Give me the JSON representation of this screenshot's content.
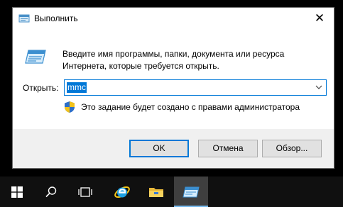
{
  "dialog": {
    "title": "Выполнить",
    "close_glyph": "✕",
    "description": "Введите имя программы, папки, документа или ресурса Интернета, которые требуется открыть.",
    "open_label": "Открыть:",
    "open_value": "mmc",
    "admin_note": "Это задание будет создано с правами администратора",
    "buttons": {
      "ok": "OK",
      "cancel": "Отмена",
      "browse": "Обзор..."
    },
    "icons": {
      "title": "run-icon",
      "main": "run-icon",
      "admin": "uac-shield-icon",
      "dropdown": "chevron-down-icon"
    }
  },
  "taskbar": {
    "items": [
      "windows-start-icon",
      "search-icon",
      "task-view-icon",
      "internet-explorer-icon",
      "file-explorer-icon",
      "run-app-icon"
    ],
    "active_item": "run-app-icon",
    "accent_color": "#76b9ed"
  },
  "colors": {
    "focus_blue": "#0078d7",
    "footer_bg": "#f0f0f0",
    "taskbar_bg": "#101010"
  }
}
